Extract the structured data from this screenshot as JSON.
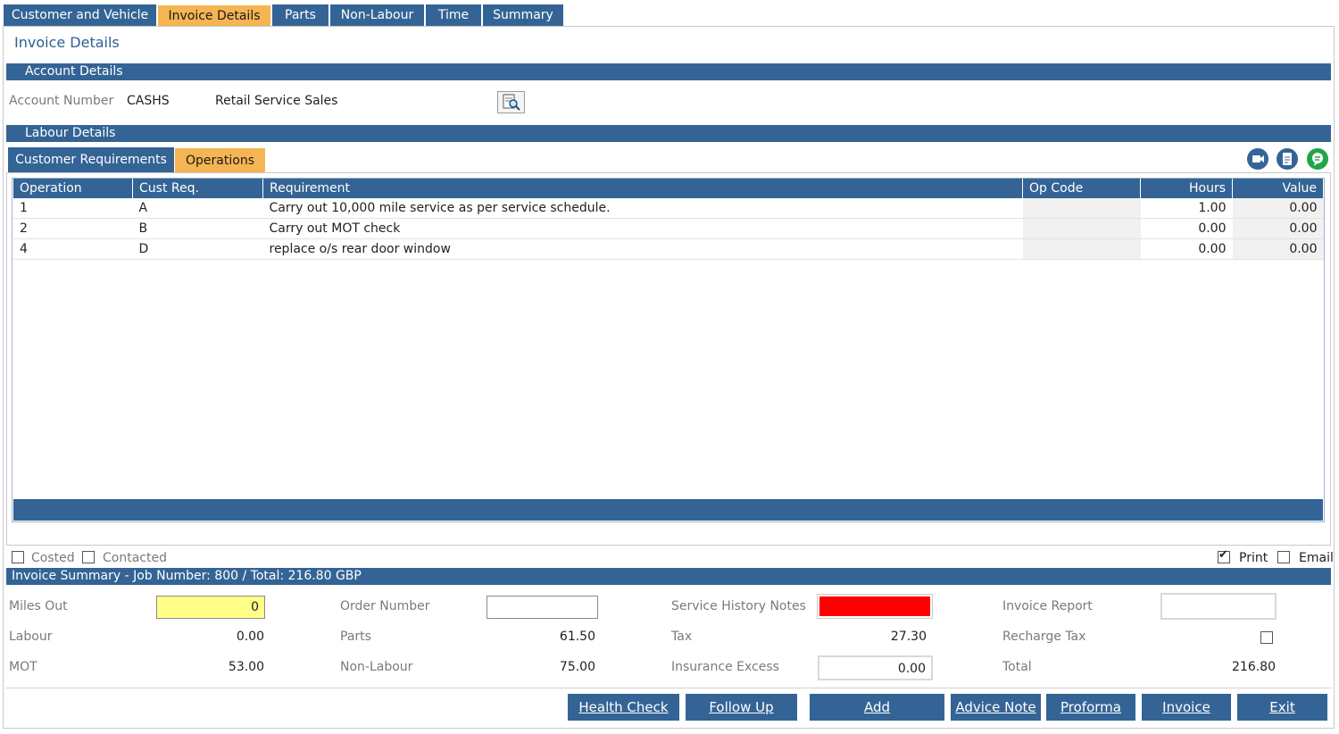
{
  "tabs": [
    "Customer and Vehicle",
    "Invoice Details",
    "Parts",
    "Non-Labour",
    "Time",
    "Summary"
  ],
  "page_title": "Invoice Details",
  "account": {
    "bar_title": "Account Details",
    "number_label": "Account Number",
    "number": "CASHS",
    "name": "Retail Service Sales"
  },
  "labour": {
    "bar_title": "Labour Details",
    "subtabs": [
      "Customer Requirements",
      "Operations"
    ],
    "columns": [
      "Operation",
      "Cust Req.",
      "Requirement",
      "Op Code",
      "Hours",
      "Value"
    ],
    "rows": [
      {
        "operation": "1",
        "cust_req": "A",
        "requirement": "Carry out 10,000 mile service as per service schedule.",
        "op_code": "",
        "hours": "1.00",
        "value": "0.00"
      },
      {
        "operation": "2",
        "cust_req": "B",
        "requirement": "Carry out MOT check",
        "op_code": "",
        "hours": "0.00",
        "value": "0.00"
      },
      {
        "operation": "4",
        "cust_req": "D",
        "requirement": "replace o/s rear door window",
        "op_code": "",
        "hours": "0.00",
        "value": "0.00"
      }
    ]
  },
  "checks": {
    "costed": "Costed",
    "contacted": "Contacted",
    "print": "Print",
    "email": "Email"
  },
  "summary": {
    "bar_title": "Invoice Summary - Job Number: 800 / Total: 216.80 GBP",
    "miles_out_label": "Miles Out",
    "miles_out": "0",
    "labour_label": "Labour",
    "labour": "0.00",
    "mot_label": "MOT",
    "mot": "53.00",
    "order_number_label": "Order Number",
    "order_number": "",
    "parts_label": "Parts",
    "parts": "61.50",
    "non_labour_label": "Non-Labour",
    "non_labour": "75.00",
    "service_history_label": "Service History Notes",
    "tax_label": "Tax",
    "tax": "27.30",
    "insurance_label": "Insurance Excess",
    "insurance": "0.00",
    "invoice_report_label": "Invoice Report",
    "recharge_tax_label": "Recharge Tax",
    "total_label": "Total",
    "total": "216.80"
  },
  "buttons": [
    "Health Check",
    "Follow Up",
    "Add",
    "Advice Note",
    "Proforma",
    "Invoice",
    "Exit"
  ],
  "colors": {
    "primary": "#346495",
    "active_tab": "#f5b553",
    "miles_field": "#ffff88",
    "service_notes": "#ff0000",
    "green_icon": "#21a546"
  },
  "icons": [
    "magnifier-document-icon",
    "video-icon",
    "document-icon",
    "chat-icon"
  ]
}
